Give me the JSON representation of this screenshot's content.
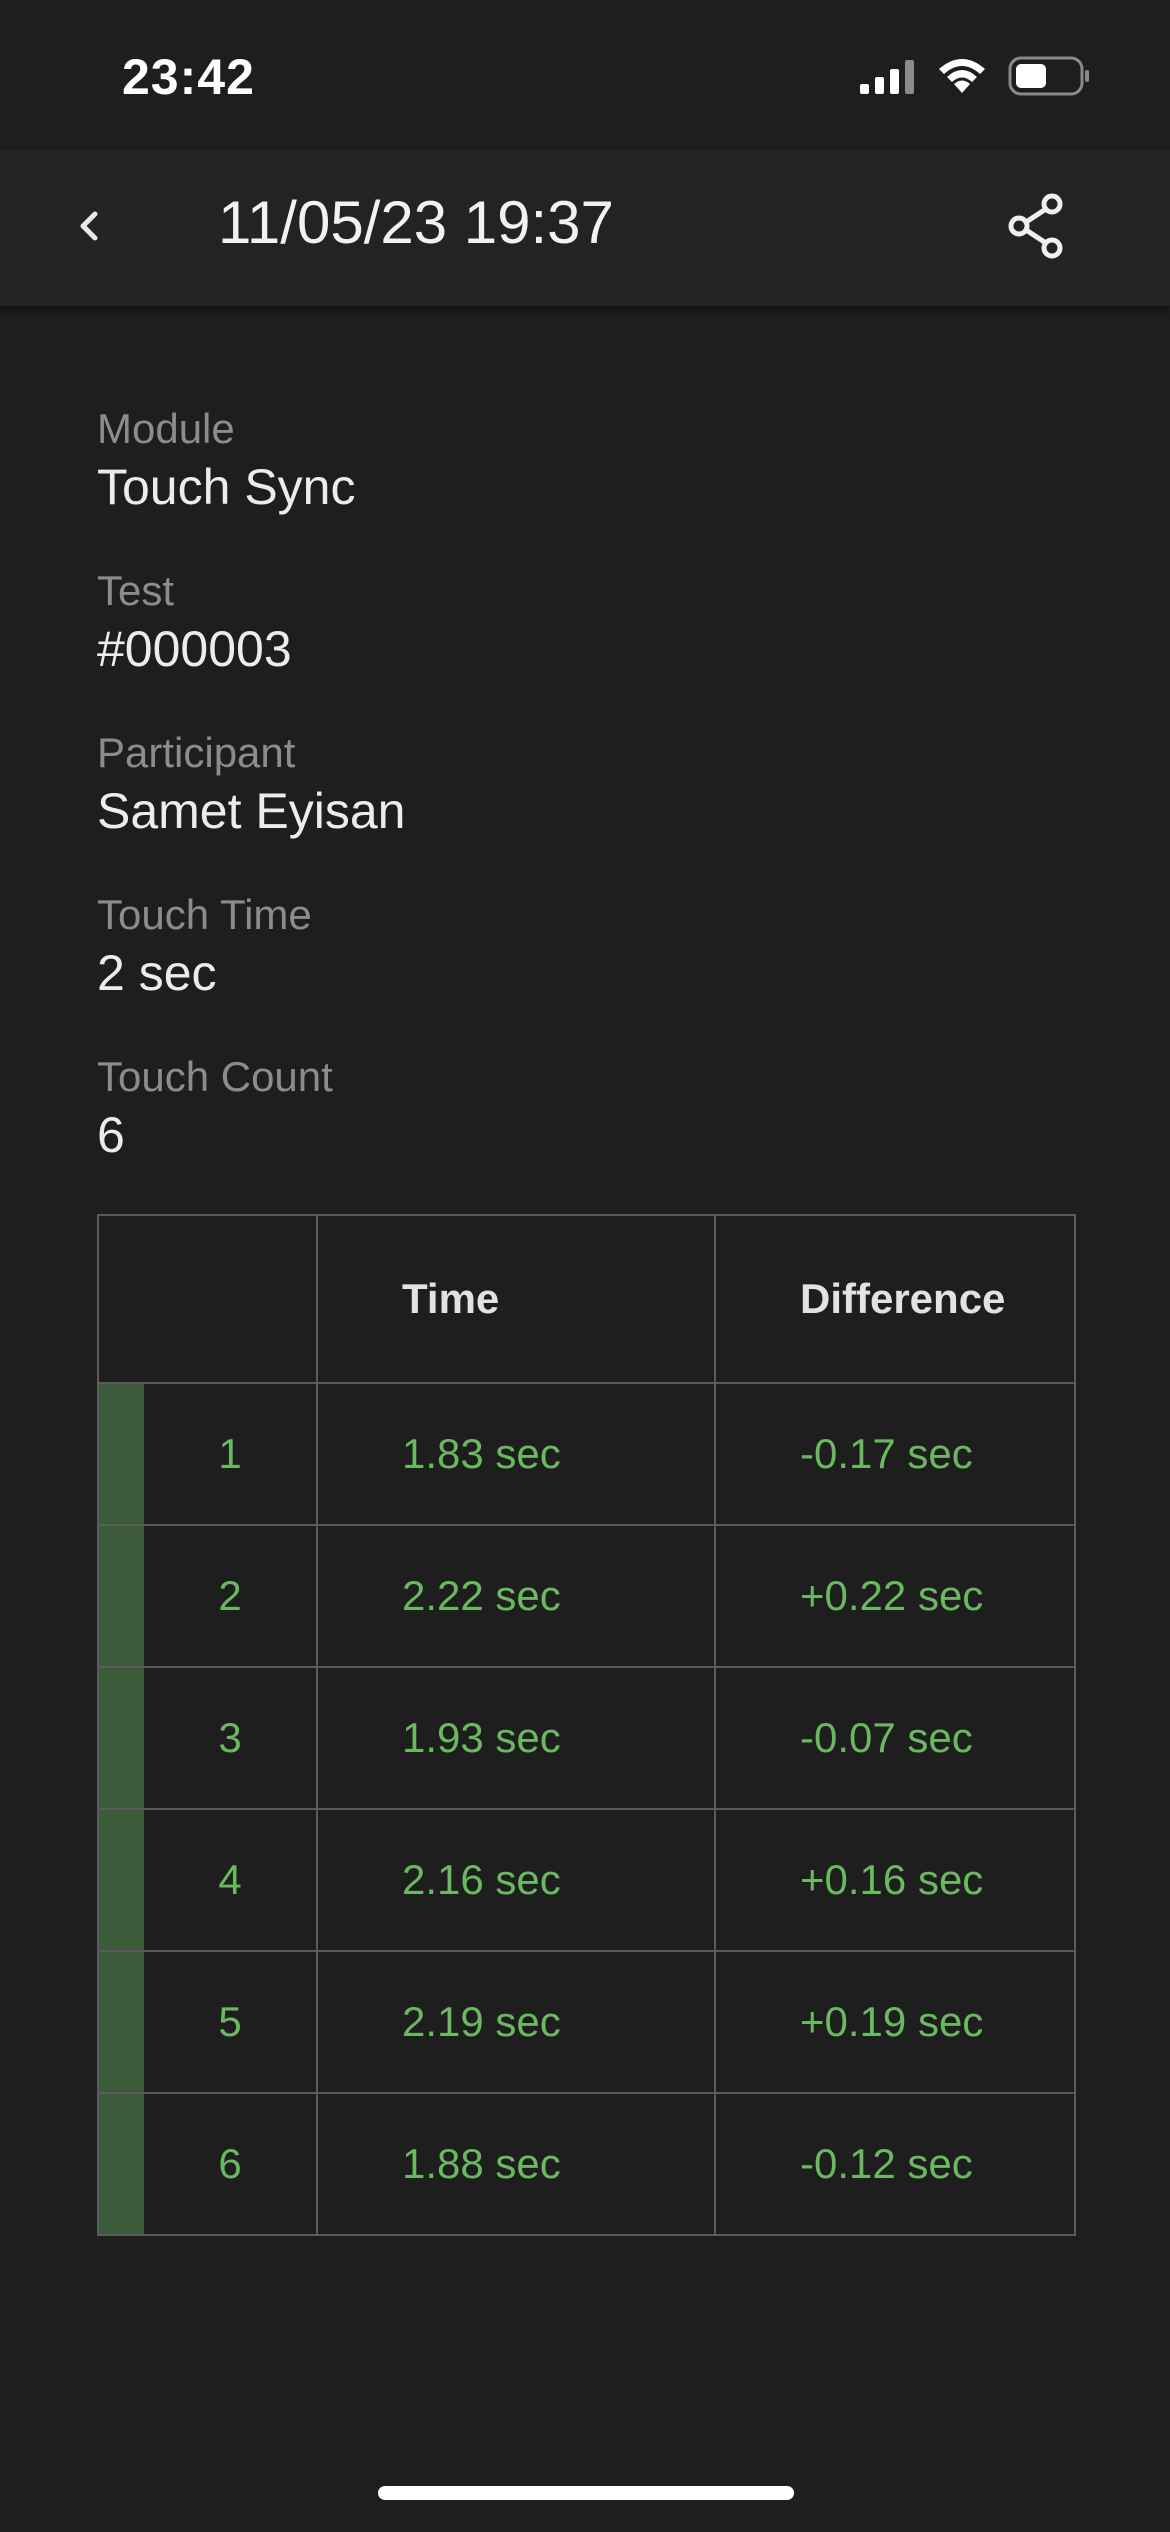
{
  "status_bar": {
    "time": "23:42",
    "icons": [
      "cellular-signal-icon",
      "wifi-icon",
      "battery-icon"
    ]
  },
  "app_bar": {
    "title": "11/05/23 19:37",
    "back_icon": "chevron-left-icon",
    "share_icon": "share-icon"
  },
  "details": [
    {
      "label": "Module",
      "value": "Touch Sync"
    },
    {
      "label": "Test",
      "value": "#000003"
    },
    {
      "label": "Participant",
      "value": "Samet Eyisan"
    },
    {
      "label": "Touch Time",
      "value": "2 sec"
    },
    {
      "label": "Touch Count",
      "value": "6"
    }
  ],
  "table": {
    "headers": [
      "",
      "Time",
      "Difference"
    ],
    "rows": [
      {
        "index": "1",
        "time": "1.83 sec",
        "difference": "-0.17 sec"
      },
      {
        "index": "2",
        "time": "2.22 sec",
        "difference": "+0.22 sec"
      },
      {
        "index": "3",
        "time": "1.93 sec",
        "difference": "-0.07 sec"
      },
      {
        "index": "4",
        "time": "2.16 sec",
        "difference": "+0.16 sec"
      },
      {
        "index": "5",
        "time": "2.19 sec",
        "difference": "+0.19 sec"
      },
      {
        "index": "6",
        "time": "1.88 sec",
        "difference": "-0.12 sec"
      }
    ]
  },
  "colors": {
    "background": "#1e1e1f",
    "app_bar": "#232324",
    "value_green": "#6ab85f",
    "row_stripe": "#3b5a3a",
    "border": "#5b5b5d"
  }
}
